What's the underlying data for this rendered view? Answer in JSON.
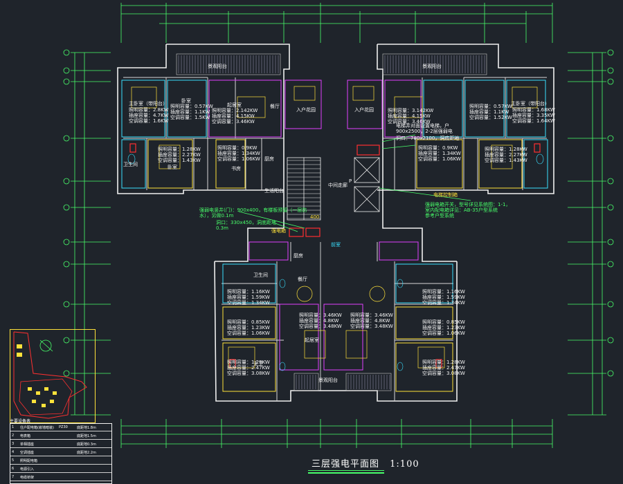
{
  "drawing": {
    "title": "三层强电平面图",
    "scale": "1:100",
    "colors": {
      "background": "#1f242b",
      "wall": "#f0f0f0",
      "grid_axis": "#48ff6a",
      "cyan": "#39e0ff",
      "magenta": "#e040ff",
      "yellow": "#ffe23a",
      "red": "#ff3030",
      "blue": "#4a7dff"
    }
  },
  "rooms": {
    "ul_bedroom1_name": "主卧室（带阳台）",
    "ul_bedroom1_power": "照明容量：2.8KW\n插座容量：4.7KW\n空调容量：1.6KW",
    "ul_bedroom2_name": "卧室",
    "ul_bedroom2_power": "照明容量：0.57KW\n插座容量：1.1KW\n空调容量：1.5KW",
    "ul_living_name": "起居室",
    "ul_living_power": "照明容量：2.142KW\n插座容量：4.15KW\n空调容量：3.46KW",
    "ul_dining": "餐厅",
    "ul_entrance": "入户花园",
    "ul_bedroom3_power": "照明容量：1.28KW\n插座容量：2.27KW\n空调容量：1.43KW",
    "ul_bedroom3_name": "卧室",
    "ul_bath": "卫生间",
    "ul_study_power": "照明容量：0.9KW\n插座容量：1.34KW\n空调容量：1.06KW",
    "ul_study_name": "书房",
    "ul_kitchen": "厨房",
    "ul_laundry": "生活阳台",
    "ur_living_power": "照明容量：3.142KW\n插座容量：4.15KW\n空调容量：3.46KW",
    "ur_bedroom1_name": "主卧室（带阳台）",
    "ur_bedroom1_power": "照明容量：1.68KW\n插座容量：3.35KW\n空调容量：1.64KW",
    "ur_bedroom2_power": "照明容量：0.57KW\n插座容量：1.1KW\n空调容量：1.52KW",
    "ur_study_power": "照明容量：0.9KW\n插座容量：1.34KW\n空调容量：1.06KW",
    "ur_bedroom3_power": "照明容量：1.28KW\n插座容量：2.27KW\n空调容量：1.43KW",
    "ur_balcony": "景观阳台",
    "ul_balcony": "景观阳台",
    "ur_entrance": "入户花园",
    "corridor": "中间走廊",
    "stair_label": "前室",
    "elevator_label": "P",
    "box_label": "400",
    "ll_kitchen": "厨房",
    "ll_dining_name": "餐厅",
    "ll_bedroom1_power": "照明容量：1.16KW\n插座容量：1.59KW\n空调容量：1.34KW",
    "ll_bedroom2_power": "照明容量：0.85KW\n插座容量：1.23KW\n空调容量：1.06KW",
    "ll_bedroom3_power": "照明容量：1.28KW\n插座容量：2.47KW\n空调容量：3.08KW",
    "ll_living_power": "照明容量：3.46KW\n插座容量：4.8KW\n空调容量：3.48KW",
    "ll_living_name": "起居室",
    "lr_living_power": "照明容量：3.46KW\n插座容量：4.8KW\n空调容量：3.48KW",
    "lr_bedroom1_power": "照明容量：1.16KW\n插座容量：1.59KW\n空调容量：1.34KW",
    "lr_bedroom2_power": "照明容量：0.85KW\n插座容量：1.23KW\n空调容量：1.06KW",
    "lr_bedroom3_power": "照明容量：1.28KW\n插座容量：2.47KW\n空调容量：3.08KW",
    "lower_balcony": "景观阳台",
    "lower_bath": "卫生间",
    "lower_bath2": "主卫"
  },
  "annotations": {
    "left_note": "强弱电竖井(门)：900x400，有楼板预留（一层防\n水），另做0.1m",
    "left_note2": "洞口：330x450，洞底距地\n0.3m",
    "left_box": "强电箱",
    "right_note": "电梯井对面设置电梯，户\n900x2500，2-2层强弱电",
    "right_note2": "洞口：780x2100，洞底距地",
    "right_note3": "电梯控制箱",
    "right_note4": "强弱电箱开关，型号详见系统图：1-1，\n室内配电箱详见：AB-35户型系统\n参考户型系统"
  },
  "legend": {
    "header": "主要设备表",
    "rows": [
      {
        "no": "1",
        "name": "住户配电箱(嵌墙暗装)",
        "spec": "PZ30",
        "note": "底距地1.8m"
      },
      {
        "no": "2",
        "name": "电表箱",
        "spec": "",
        "note": "底距地1.5m"
      },
      {
        "no": "3",
        "name": "单相插座",
        "spec": "",
        "note": "底距地0.3m"
      },
      {
        "no": "4",
        "name": "空调插座",
        "spec": "",
        "note": "底距地2.2m"
      },
      {
        "no": "5",
        "name": "照明配电箱",
        "spec": "",
        "note": ""
      },
      {
        "no": "6",
        "name": "电源引入",
        "spec": "",
        "note": ""
      },
      {
        "no": "7",
        "name": "电缆桥架",
        "spec": "",
        "note": ""
      }
    ]
  }
}
